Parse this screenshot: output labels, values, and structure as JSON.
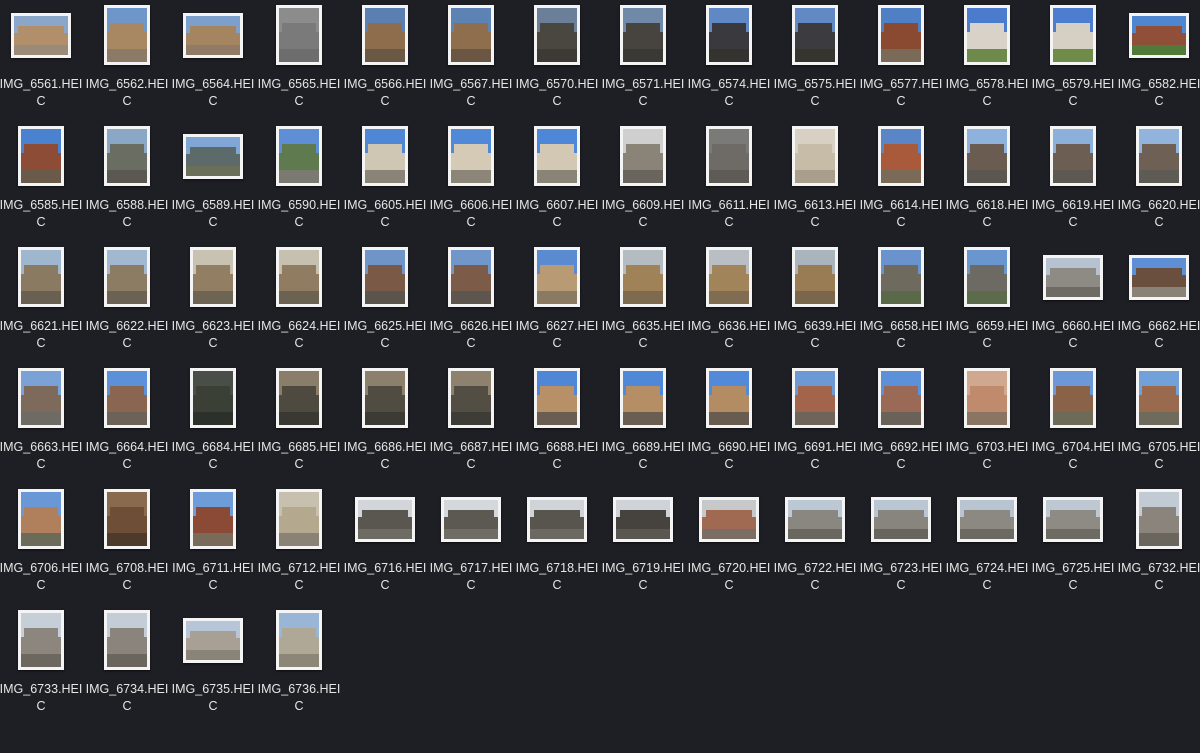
{
  "files": [
    {
      "name": "IMG_6561.HEIC",
      "orientation": "landscape",
      "sky": "#8aa6c8",
      "fill": "#b08f6a",
      "ground": "#9a8a78"
    },
    {
      "name": "IMG_6562.HEIC",
      "orientation": "portrait",
      "sky": "#6f96c9",
      "fill": "#a88763",
      "ground": "#8d7a66"
    },
    {
      "name": "IMG_6564.HEIC",
      "orientation": "landscape",
      "sky": "#7d9fcb",
      "fill": "#a58560",
      "ground": "#8f7b66"
    },
    {
      "name": "IMG_6565.HEIC",
      "orientation": "portrait",
      "sky": "#8c8c8c",
      "fill": "#7a7a7a",
      "ground": "#6d6d6d"
    },
    {
      "name": "IMG_6566.HEIC",
      "orientation": "portrait",
      "sky": "#5a7fb0",
      "fill": "#8e6d4d",
      "ground": "#6b5844"
    },
    {
      "name": "IMG_6567.HEIC",
      "orientation": "portrait",
      "sky": "#5d83b5",
      "fill": "#8f6e4e",
      "ground": "#6a5642"
    },
    {
      "name": "IMG_6570.HEIC",
      "orientation": "portrait",
      "sky": "#6b7f99",
      "fill": "#4a4640",
      "ground": "#3d3a36"
    },
    {
      "name": "IMG_6571.HEIC",
      "orientation": "portrait",
      "sky": "#7089a8",
      "fill": "#474440",
      "ground": "#3b3935"
    },
    {
      "name": "IMG_6574.HEIC",
      "orientation": "portrait",
      "sky": "#5f88c4",
      "fill": "#3a3a3e",
      "ground": "#34332f"
    },
    {
      "name": "IMG_6575.HEIC",
      "orientation": "portrait",
      "sky": "#6289c3",
      "fill": "#3c3b3f",
      "ground": "#36342f"
    },
    {
      "name": "IMG_6577.HEIC",
      "orientation": "portrait",
      "sky": "#4f7fc4",
      "fill": "#8a4a32",
      "ground": "#7a6a58"
    },
    {
      "name": "IMG_6578.HEIC",
      "orientation": "portrait",
      "sky": "#4a7bcc",
      "fill": "#d8d2c8",
      "ground": "#6d8a4a"
    },
    {
      "name": "IMG_6579.HEIC",
      "orientation": "portrait",
      "sky": "#4c7dce",
      "fill": "#d6cfc4",
      "ground": "#6e8b48"
    },
    {
      "name": "IMG_6582.HEIC",
      "orientation": "landscape",
      "sky": "#4e86d0",
      "fill": "#8f4f38",
      "ground": "#4f7a3a"
    },
    {
      "name": "IMG_6585.HEIC",
      "orientation": "portrait",
      "sky": "#4a82d0",
      "fill": "#8c4c36",
      "ground": "#6a5a4a"
    },
    {
      "name": "IMG_6588.HEIC",
      "orientation": "portrait",
      "sky": "#8aa8c6",
      "fill": "#6a6e62",
      "ground": "#5a5850"
    },
    {
      "name": "IMG_6589.HEIC",
      "orientation": "landscape",
      "sky": "#7fa6d4",
      "fill": "#5c6a6a",
      "ground": "#6a6f5a"
    },
    {
      "name": "IMG_6590.HEIC",
      "orientation": "portrait",
      "sky": "#5e8ed6",
      "fill": "#5e7a4e",
      "ground": "#7a7a70"
    },
    {
      "name": "IMG_6605.HEIC",
      "orientation": "portrait",
      "sky": "#4f86d6",
      "fill": "#cfc6b4",
      "ground": "#8a8478"
    },
    {
      "name": "IMG_6606.HEIC",
      "orientation": "portrait",
      "sky": "#5189d8",
      "fill": "#d4cab6",
      "ground": "#8c8678"
    },
    {
      "name": "IMG_6607.HEIC",
      "orientation": "portrait",
      "sky": "#4e87d8",
      "fill": "#d2c8b4",
      "ground": "#8a8476"
    },
    {
      "name": "IMG_6609.HEIC",
      "orientation": "portrait",
      "sky": "#cfcfcf",
      "fill": "#8a8478",
      "ground": "#6a655c"
    },
    {
      "name": "IMG_6611.HEIC",
      "orientation": "portrait",
      "sky": "#7a7a76",
      "fill": "#6e6b66",
      "ground": "#5e5b56"
    },
    {
      "name": "IMG_6613.HEIC",
      "orientation": "portrait",
      "sky": "#d8d0c2",
      "fill": "#c7bca8",
      "ground": "#a99e8c"
    },
    {
      "name": "IMG_6614.HEIC",
      "orientation": "portrait",
      "sky": "#5a86c8",
      "fill": "#a85a3a",
      "ground": "#7a6a58"
    },
    {
      "name": "IMG_6618.HEIC",
      "orientation": "portrait",
      "sky": "#8fb2dc",
      "fill": "#6a5c50",
      "ground": "#5a5650"
    },
    {
      "name": "IMG_6619.HEIC",
      "orientation": "portrait",
      "sky": "#8cb0da",
      "fill": "#6c5e52",
      "ground": "#5c5852"
    },
    {
      "name": "IMG_6620.HEIC",
      "orientation": "portrait",
      "sky": "#92b4dc",
      "fill": "#6e6054",
      "ground": "#5e5a54"
    },
    {
      "name": "IMG_6621.HEIC",
      "orientation": "portrait",
      "sky": "#9fb6cf",
      "fill": "#8a7a62",
      "ground": "#6a6052"
    },
    {
      "name": "IMG_6622.HEIC",
      "orientation": "portrait",
      "sky": "#a2b8d0",
      "fill": "#8c7c64",
      "ground": "#6c6254"
    },
    {
      "name": "IMG_6623.HEIC",
      "orientation": "portrait",
      "sky": "#c8c2b2",
      "fill": "#927e62",
      "ground": "#6e6454"
    },
    {
      "name": "IMG_6624.HEIC",
      "orientation": "portrait",
      "sky": "#c6c0b0",
      "fill": "#907c60",
      "ground": "#6c6252"
    },
    {
      "name": "IMG_6625.HEIC",
      "orientation": "portrait",
      "sky": "#6e94c8",
      "fill": "#7a5a46",
      "ground": "#5a544c"
    },
    {
      "name": "IMG_6626.HEIC",
      "orientation": "portrait",
      "sky": "#7096ca",
      "fill": "#7c5c48",
      "ground": "#5c564e"
    },
    {
      "name": "IMG_6627.HEIC",
      "orientation": "portrait",
      "sky": "#5a8ad0",
      "fill": "#b89a74",
      "ground": "#8a7a62"
    },
    {
      "name": "IMG_6635.HEIC",
      "orientation": "portrait",
      "sky": "#b4bcc2",
      "fill": "#a08258",
      "ground": "#7e6a4e"
    },
    {
      "name": "IMG_6636.HEIC",
      "orientation": "portrait",
      "sky": "#b8bec4",
      "fill": "#a2845a",
      "ground": "#806c50"
    },
    {
      "name": "IMG_6639.HEIC",
      "orientation": "portrait",
      "sky": "#aab4bc",
      "fill": "#9a7c54",
      "ground": "#7a664a"
    },
    {
      "name": "IMG_6658.HEIC",
      "orientation": "portrait",
      "sky": "#6a92cc",
      "fill": "#6e6a5e",
      "ground": "#5a6a48"
    },
    {
      "name": "IMG_6659.HEIC",
      "orientation": "portrait",
      "sky": "#6a96d0",
      "fill": "#6c6a62",
      "ground": "#5c6c4a"
    },
    {
      "name": "IMG_6660.HEIC",
      "orientation": "landscape",
      "sky": "#b6c2d0",
      "fill": "#8e8a84",
      "ground": "#6e6a64"
    },
    {
      "name": "IMG_6662.HEIC",
      "orientation": "landscape",
      "sky": "#5e8ed4",
      "fill": "#6a4e3e",
      "ground": "#8a8276"
    },
    {
      "name": "IMG_6663.HEIC",
      "orientation": "portrait",
      "sky": "#7aa2d6",
      "fill": "#7e6a5a",
      "ground": "#6e6a64"
    },
    {
      "name": "IMG_6664.HEIC",
      "orientation": "portrait",
      "sky": "#5c90d8",
      "fill": "#8a6650",
      "ground": "#6c6258"
    },
    {
      "name": "IMG_6684.HEIC",
      "orientation": "portrait",
      "sky": "#4a4e48",
      "fill": "#3a4036",
      "ground": "#2c302a"
    },
    {
      "name": "IMG_6685.HEIC",
      "orientation": "portrait",
      "sky": "#8a7e6a",
      "fill": "#4e4a40",
      "ground": "#3a3832"
    },
    {
      "name": "IMG_6686.HEIC",
      "orientation": "portrait",
      "sky": "#8c806c",
      "fill": "#504c42",
      "ground": "#3c3a34"
    },
    {
      "name": "IMG_6687.HEIC",
      "orientation": "portrait",
      "sky": "#8e826e",
      "fill": "#524e44",
      "ground": "#3e3c36"
    },
    {
      "name": "IMG_6688.HEIC",
      "orientation": "portrait",
      "sky": "#4f86d6",
      "fill": "#b89068",
      "ground": "#6a5e52"
    },
    {
      "name": "IMG_6689.HEIC",
      "orientation": "portrait",
      "sky": "#5088d8",
      "fill": "#b68e66",
      "ground": "#6a5e52"
    },
    {
      "name": "IMG_6690.HEIC",
      "orientation": "portrait",
      "sky": "#5289d8",
      "fill": "#b48c64",
      "ground": "#685c50"
    },
    {
      "name": "IMG_6691.HEIC",
      "orientation": "portrait",
      "sky": "#6c98d4",
      "fill": "#a2644a",
      "ground": "#6e645a"
    },
    {
      "name": "IMG_6692.HEIC",
      "orientation": "portrait",
      "sky": "#5c90d8",
      "fill": "#9a6a56",
      "ground": "#6a6258"
    },
    {
      "name": "IMG_6703.HEIC",
      "orientation": "portrait",
      "sky": "#d0a890",
      "fill": "#c08a6c",
      "ground": "#8a7462"
    },
    {
      "name": "IMG_6704.HEIC",
      "orientation": "portrait",
      "sky": "#6c98d8",
      "fill": "#8a6248",
      "ground": "#6e6a58"
    },
    {
      "name": "IMG_6705.HEIC",
      "orientation": "portrait",
      "sky": "#72a0d8",
      "fill": "#9a6a4e",
      "ground": "#6e6a5c"
    },
    {
      "name": "IMG_6706.HEIC",
      "orientation": "portrait",
      "sky": "#6a98d6",
      "fill": "#b0805c",
      "ground": "#6c6a58"
    },
    {
      "name": "IMG_6708.HEIC",
      "orientation": "portrait",
      "sky": "#8a6a4e",
      "fill": "#6e4e36",
      "ground": "#4e3a2a"
    },
    {
      "name": "IMG_6711.HEIC",
      "orientation": "portrait",
      "sky": "#6e9cd8",
      "fill": "#8a4a36",
      "ground": "#7a6a5a"
    },
    {
      "name": "IMG_6712.HEIC",
      "orientation": "portrait",
      "sky": "#c8c0ae",
      "fill": "#b4a88e",
      "ground": "#8a8274"
    },
    {
      "name": "IMG_6716.HEIC",
      "orientation": "landscape",
      "sky": "#d2d6da",
      "fill": "#5a5650",
      "ground": "#6e6a64"
    },
    {
      "name": "IMG_6717.HEIC",
      "orientation": "landscape",
      "sky": "#d4d8dc",
      "fill": "#5c5852",
      "ground": "#706c66"
    },
    {
      "name": "IMG_6718.HEIC",
      "orientation": "landscape",
      "sky": "#d0d4d8",
      "fill": "#58544e",
      "ground": "#6c6862"
    },
    {
      "name": "IMG_6719.HEIC",
      "orientation": "landscape",
      "sky": "#cfd3d7",
      "fill": "#46423e",
      "ground": "#5a5650"
    },
    {
      "name": "IMG_6720.HEIC",
      "orientation": "landscape",
      "sky": "#c6c8ca",
      "fill": "#a06a52",
      "ground": "#7a6e64"
    },
    {
      "name": "IMG_6722.HEIC",
      "orientation": "landscape",
      "sky": "#bcc8d4",
      "fill": "#8a8680",
      "ground": "#6a6660"
    },
    {
      "name": "IMG_6723.HEIC",
      "orientation": "landscape",
      "sky": "#bac6d2",
      "fill": "#88847e",
      "ground": "#68645e"
    },
    {
      "name": "IMG_6724.HEIC",
      "orientation": "landscape",
      "sky": "#b8c4d0",
      "fill": "#8c8882",
      "ground": "#6c6862"
    },
    {
      "name": "IMG_6725.HEIC",
      "orientation": "landscape",
      "sky": "#bec8d2",
      "fill": "#8e8a84",
      "ground": "#6e6a64"
    },
    {
      "name": "IMG_6732.HEIC",
      "orientation": "portrait",
      "sky": "#c2cad4",
      "fill": "#8a847c",
      "ground": "#6a665e"
    },
    {
      "name": "IMG_6733.HEIC",
      "orientation": "portrait",
      "sky": "#c6ced8",
      "fill": "#8c867e",
      "ground": "#6c6860"
    },
    {
      "name": "IMG_6734.HEIC",
      "orientation": "portrait",
      "sky": "#c4ccd6",
      "fill": "#8a847c",
      "ground": "#6a665e"
    },
    {
      "name": "IMG_6735.HEIC",
      "orientation": "landscape",
      "sky": "#b6c6d8",
      "fill": "#a8a094",
      "ground": "#8a8478"
    },
    {
      "name": "IMG_6736.HEIC",
      "orientation": "portrait",
      "sky": "#9ab6d6",
      "fill": "#b0a896",
      "ground": "#8c8678"
    }
  ]
}
